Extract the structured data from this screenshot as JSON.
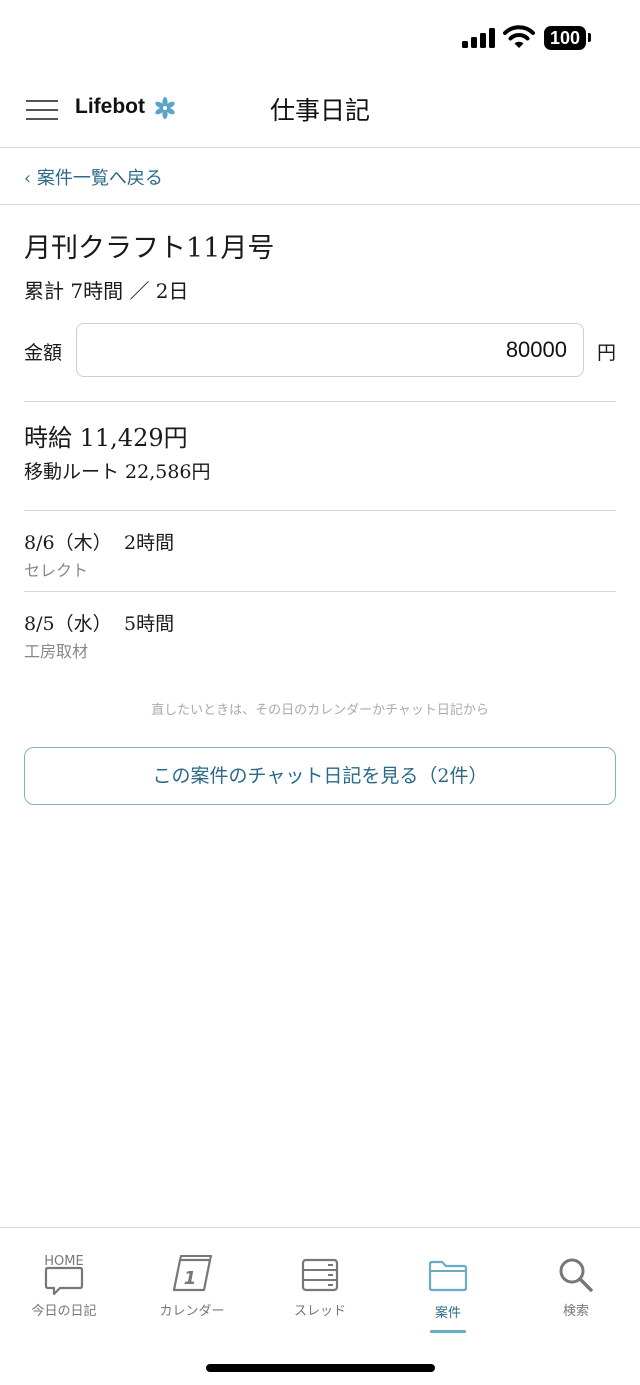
{
  "status_bar": {
    "battery": "100"
  },
  "header": {
    "brand": "Lifebot",
    "title": "仕事日記"
  },
  "back_link": {
    "label": "‹ 案件一覧へ戻る"
  },
  "project": {
    "title": "月刊クラフト11月号",
    "totals": "累計 7時間 ／ 2日",
    "amount_label": "金額",
    "amount_value": "80000",
    "amount_unit": "円",
    "hourly_rate": "時給 11,429円",
    "route": "移動ルート 22,586円"
  },
  "entries": [
    {
      "date": "8/6（木）",
      "hours": "2時間",
      "note": "セレクト"
    },
    {
      "date": "8/5（水）",
      "hours": "5時間",
      "note": "工房取材"
    }
  ],
  "hint": "直したいときは、その日のカレンダーかチャット日記から",
  "chat_button": {
    "label": "この案件のチャット日記を見る（2件）"
  },
  "tabs": [
    {
      "label": "今日の日記",
      "icon": "chat-bubble-icon",
      "sup": "HOME"
    },
    {
      "label": "カレンダー",
      "icon": "calendar-icon",
      "day": "1"
    },
    {
      "label": "スレッド",
      "icon": "threads-icon"
    },
    {
      "label": "案件",
      "icon": "folder-icon",
      "active": true
    },
    {
      "label": "検索",
      "icon": "search-icon"
    }
  ],
  "colors": {
    "accent": "#2a6a88",
    "accent_light": "#6aaac4",
    "border": "#d9d9d9"
  }
}
